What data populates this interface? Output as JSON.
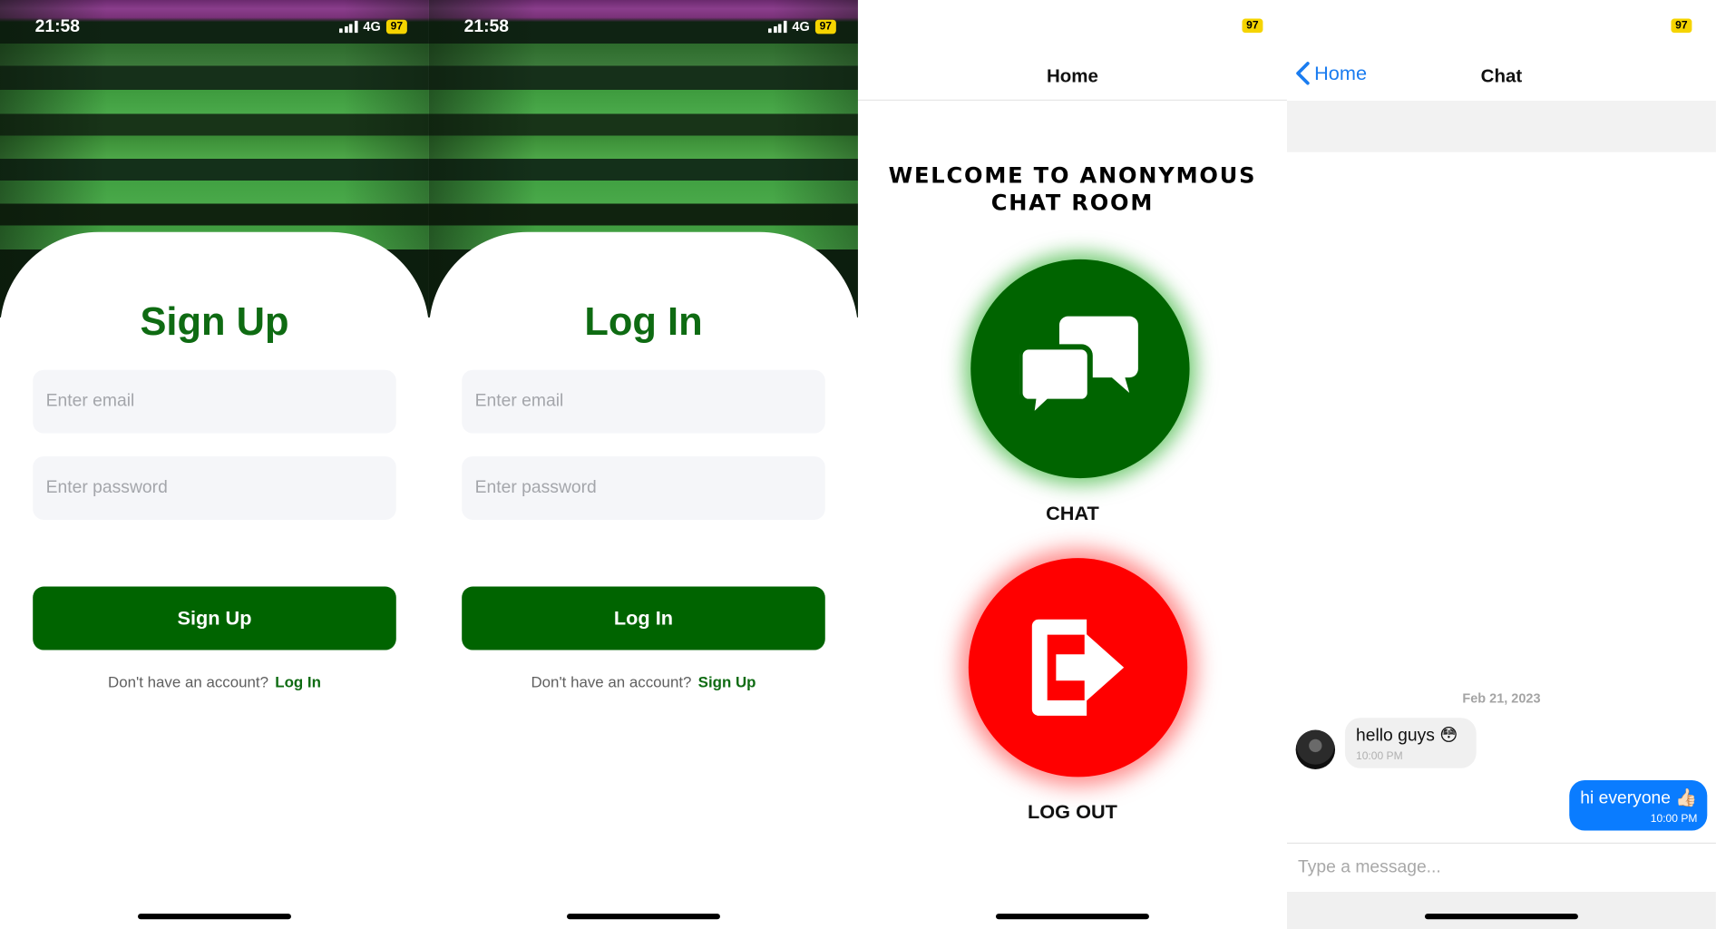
{
  "colors": {
    "brand_green": "#006400",
    "title_green": "#0e6b12",
    "logout_red": "#ff0000",
    "ios_blue": "#1a7cf0",
    "battery_yellow": "#f5d400"
  },
  "status": {
    "time": "21:58",
    "network": "4G",
    "battery": "97"
  },
  "signup": {
    "title": "Sign Up",
    "email_placeholder": "Enter email",
    "password_placeholder": "Enter password",
    "button": "Sign Up",
    "footer_question": "Don't have an account?",
    "footer_link": "Log In"
  },
  "login": {
    "title": "Log In",
    "email_placeholder": "Enter email",
    "password_placeholder": "Enter password",
    "button": "Log In",
    "footer_question": "Don't have an account?",
    "footer_link": "Sign Up"
  },
  "home": {
    "nav_title": "Home",
    "welcome_line1": "WELCOME TO ANONYMOUS",
    "welcome_line2": "CHAT ROOM",
    "chat_icon": "chat-bubbles-icon",
    "chat_label": "CHAT",
    "logout_icon": "logout-exit-icon",
    "logout_label": "LOG OUT"
  },
  "chat": {
    "back_label": "Home",
    "nav_title": "Chat",
    "date_divider": "Feb 21, 2023",
    "messages": [
      {
        "direction": "incoming",
        "text": "hello guys 😳",
        "time": "10:00 PM"
      },
      {
        "direction": "outgoing",
        "text": "hi everyone 👍🏻",
        "time": "10:00 PM"
      }
    ],
    "composer_placeholder": "Type a message..."
  }
}
